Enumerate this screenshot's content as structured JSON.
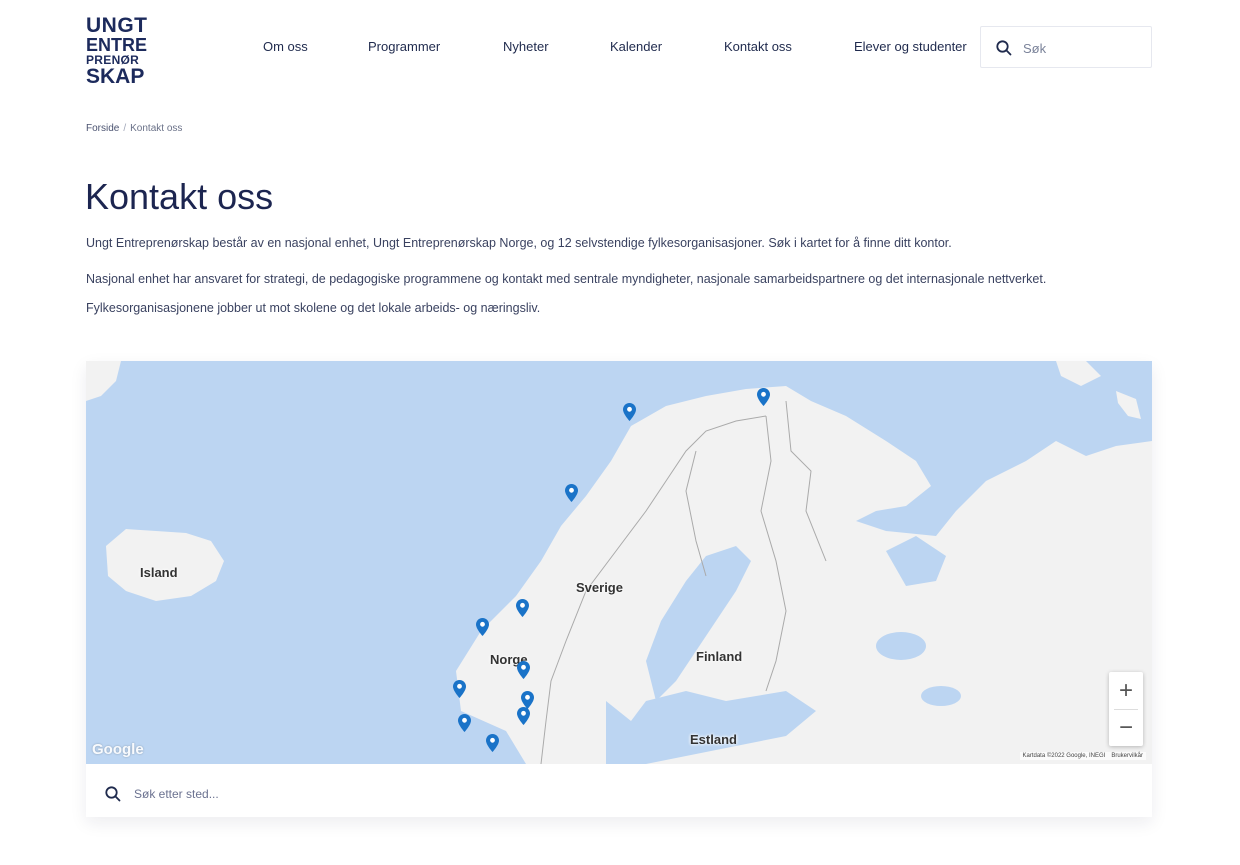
{
  "logo": {
    "line1": "UNGT",
    "line2": "ENTRE",
    "line3": "PRENØR",
    "line4": "SKAP"
  },
  "nav": {
    "items": [
      {
        "label": "Om oss"
      },
      {
        "label": "Programmer"
      },
      {
        "label": "Nyheter"
      },
      {
        "label": "Kalender"
      },
      {
        "label": "Kontakt oss"
      },
      {
        "label": "Elever og studenter"
      }
    ]
  },
  "search": {
    "placeholder": "Søk"
  },
  "breadcrumb": {
    "home": "Forside",
    "separator": "/",
    "current": "Kontakt oss"
  },
  "page": {
    "title": "Kontakt oss",
    "paragraph1": "Ungt Entreprenørskap består av en nasjonal enhet, Ungt Entreprenørskap Norge, og 12 selvstendige fylkesorganisasjoner. Søk i kartet for å finne ditt kontor.",
    "paragraph2": "Nasjonal enhet har ansvaret for strategi, de pedagogiske programmene og kontakt med sentrale myndigheter, nasjonale samarbeidspartnere og det internasjonale nettverket. Fylkesorganisasjonene jobber ut mot skolene og det lokale arbeids- og næringsliv."
  },
  "map": {
    "labels": {
      "island": "Island",
      "sverige": "Sverige",
      "norge": "Norge",
      "finland": "Finland",
      "estland": "Estland"
    },
    "zoom_in": "+",
    "zoom_out": "−",
    "google": "Google",
    "attribution": "Kartdata ©2022 Google, INEGI",
    "terms": "Brukervilkår",
    "pin_color": "#1a73c8",
    "water_color": "#bcd5f2",
    "land_color": "#f2f2f2",
    "search_placeholder": "Søk etter sted..."
  }
}
